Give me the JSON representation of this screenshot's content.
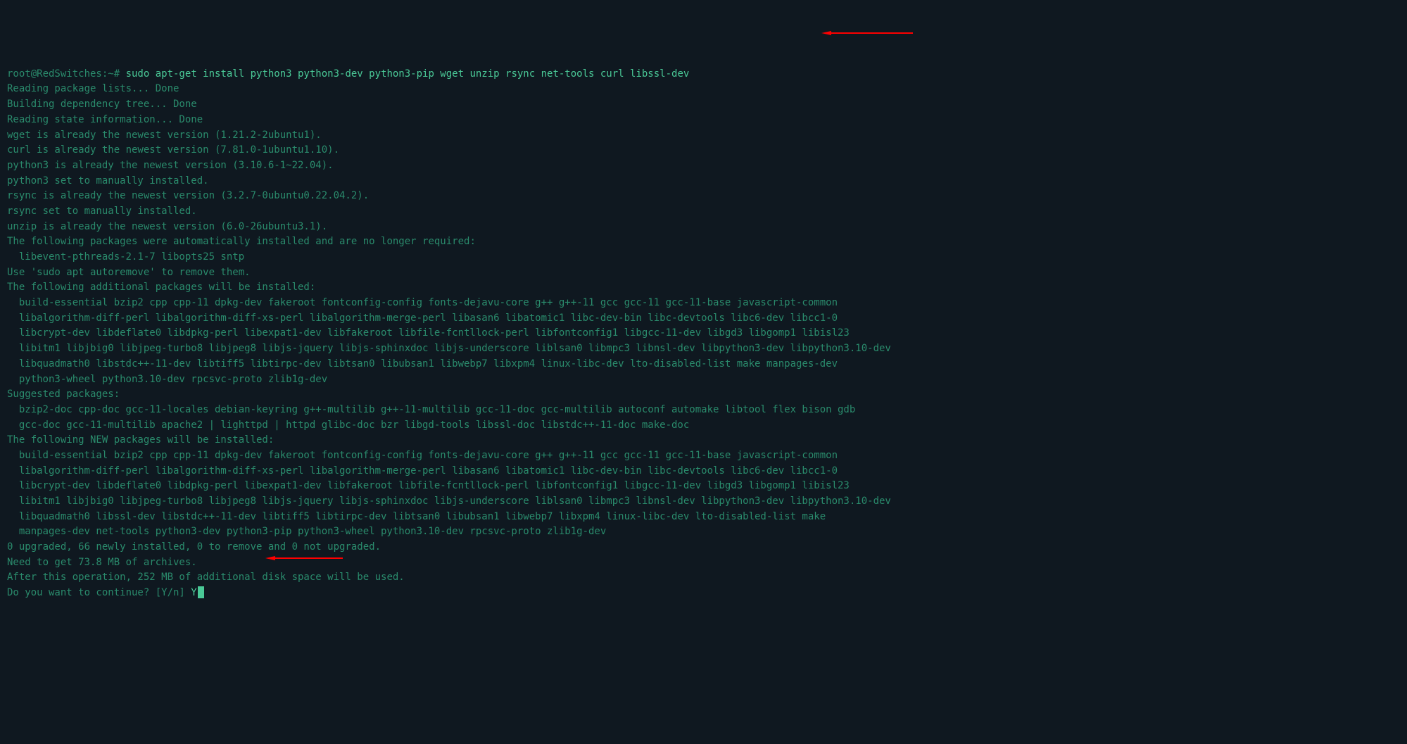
{
  "prompt": {
    "user_host": "root@RedSwitches:~# ",
    "command": "sudo apt-get install python3 python3-dev python3-pip wget unzip rsync net-tools curl libssl-dev"
  },
  "lines": {
    "l1": "Reading package lists... Done",
    "l2": "Building dependency tree... Done",
    "l3": "Reading state information... Done",
    "l4": "wget is already the newest version (1.21.2-2ubuntu1).",
    "l5": "curl is already the newest version (7.81.0-1ubuntu1.10).",
    "l6": "python3 is already the newest version (3.10.6-1~22.04).",
    "l7": "python3 set to manually installed.",
    "l8": "rsync is already the newest version (3.2.7-0ubuntu0.22.04.2).",
    "l9": "rsync set to manually installed.",
    "l10": "unzip is already the newest version (6.0-26ubuntu3.1).",
    "l11": "The following packages were automatically installed and are no longer required:",
    "l12": "libevent-pthreads-2.1-7 libopts25 sntp",
    "l13": "Use 'sudo apt autoremove' to remove them.",
    "l14": "The following additional packages will be installed:",
    "l15": "build-essential bzip2 cpp cpp-11 dpkg-dev fakeroot fontconfig-config fonts-dejavu-core g++ g++-11 gcc gcc-11 gcc-11-base javascript-common",
    "l16": "libalgorithm-diff-perl libalgorithm-diff-xs-perl libalgorithm-merge-perl libasan6 libatomic1 libc-dev-bin libc-devtools libc6-dev libcc1-0",
    "l17": "libcrypt-dev libdeflate0 libdpkg-perl libexpat1-dev libfakeroot libfile-fcntllock-perl libfontconfig1 libgcc-11-dev libgd3 libgomp1 libisl23",
    "l18": "libitm1 libjbig0 libjpeg-turbo8 libjpeg8 libjs-jquery libjs-sphinxdoc libjs-underscore liblsan0 libmpc3 libnsl-dev libpython3-dev libpython3.10-dev",
    "l19": "libquadmath0 libstdc++-11-dev libtiff5 libtirpc-dev libtsan0 libubsan1 libwebp7 libxpm4 linux-libc-dev lto-disabled-list make manpages-dev",
    "l20": "python3-wheel python3.10-dev rpcsvc-proto zlib1g-dev",
    "l21": "Suggested packages:",
    "l22": "bzip2-doc cpp-doc gcc-11-locales debian-keyring g++-multilib g++-11-multilib gcc-11-doc gcc-multilib autoconf automake libtool flex bison gdb",
    "l23": "gcc-doc gcc-11-multilib apache2 | lighttpd | httpd glibc-doc bzr libgd-tools libssl-doc libstdc++-11-doc make-doc",
    "l24": "The following NEW packages will be installed:",
    "l25": "build-essential bzip2 cpp cpp-11 dpkg-dev fakeroot fontconfig-config fonts-dejavu-core g++ g++-11 gcc gcc-11 gcc-11-base javascript-common",
    "l26": "libalgorithm-diff-perl libalgorithm-diff-xs-perl libalgorithm-merge-perl libasan6 libatomic1 libc-dev-bin libc-devtools libc6-dev libcc1-0",
    "l27": "libcrypt-dev libdeflate0 libdpkg-perl libexpat1-dev libfakeroot libfile-fcntllock-perl libfontconfig1 libgcc-11-dev libgd3 libgomp1 libisl23",
    "l28": "libitm1 libjbig0 libjpeg-turbo8 libjpeg8 libjs-jquery libjs-sphinxdoc libjs-underscore liblsan0 libmpc3 libnsl-dev libpython3-dev libpython3.10-dev",
    "l29": "libquadmath0 libssl-dev libstdc++-11-dev libtiff5 libtirpc-dev libtsan0 libubsan1 libwebp7 libxpm4 linux-libc-dev lto-disabled-list make",
    "l30": "manpages-dev net-tools python3-dev python3-pip python3-wheel python3.10-dev rpcsvc-proto zlib1g-dev",
    "l31": "0 upgraded, 66 newly installed, 0 to remove and 0 not upgraded.",
    "l32": "Need to get 73.8 MB of archives.",
    "l33": "After this operation, 252 MB of additional disk space will be used.",
    "l34": "Do you want to continue? [Y/n] ",
    "input": "Y"
  }
}
